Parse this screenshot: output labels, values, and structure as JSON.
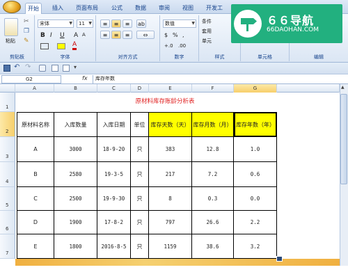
{
  "tabs": [
    "开始",
    "插入",
    "页面布局",
    "公式",
    "数据",
    "审阅",
    "视图",
    "开发工"
  ],
  "ribbon": {
    "paste": "粘贴",
    "font_name": "宋体",
    "font_size": "11",
    "number_format": "数值",
    "styles": [
      "条件",
      "套用",
      "单元"
    ],
    "groups": {
      "clipboard": "剪贴板",
      "font": "字体",
      "alignment": "对齐方式",
      "number": "数字",
      "styles": "样式",
      "cells": "单元格",
      "edit": "编辑"
    }
  },
  "watermark": {
    "title": "６６导航",
    "url": "66DAOHAN.COM"
  },
  "formula_bar": {
    "name_box": "G2",
    "fx": "fx",
    "value": "库存年数"
  },
  "columns": [
    "A",
    "B",
    "C",
    "D",
    "E",
    "F",
    "G"
  ],
  "rows": [
    "1",
    "2",
    "3",
    "4",
    "5",
    "6",
    "7"
  ],
  "sheet": {
    "title": "原材料库存账龄分析表",
    "headers": [
      "原材料名称",
      "入库数量",
      "入库日期",
      "单位",
      "库存天数（天）",
      "库存月数（月）",
      "库存年数（年）"
    ],
    "data": [
      [
        "A",
        "3000",
        "18-9-20",
        "只",
        "383",
        "12.8",
        "1.0"
      ],
      [
        "B",
        "2580",
        "19-3-5",
        "只",
        "217",
        "7.2",
        "0.6"
      ],
      [
        "C",
        "2500",
        "19-9-30",
        "只",
        "8",
        "0.3",
        "0.0"
      ],
      [
        "D",
        "1900",
        "17-8-2",
        "只",
        "797",
        "26.6",
        "2.2"
      ],
      [
        "E",
        "1800",
        "2016-8-5",
        "只",
        "1159",
        "38.6",
        "3.2"
      ]
    ]
  },
  "colors": {
    "header_fill": "#ffff00",
    "title_text": "#e02020",
    "watermark_bg": "#22b07f"
  }
}
